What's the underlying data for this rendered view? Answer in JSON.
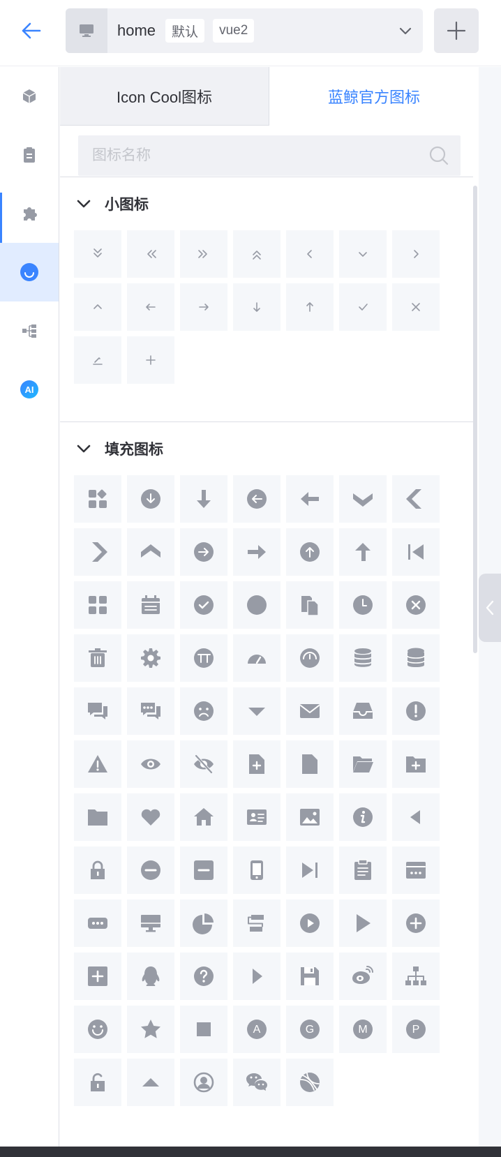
{
  "header": {
    "back_icon": "arrow-left-icon",
    "app_icon": "monitor-icon",
    "app_name": "home",
    "tags": [
      "默认",
      "vue2"
    ],
    "dropdown_icon": "chevron-down-icon",
    "add_icon": "plus-icon"
  },
  "sidebar": {
    "items": [
      {
        "icon": "cube-icon",
        "active": false
      },
      {
        "icon": "clipboard-icon",
        "active": false
      },
      {
        "icon": "puzzle-icon",
        "active": false
      },
      {
        "icon": "smiley-icon",
        "active": true
      },
      {
        "icon": "tree-icon",
        "active": false
      },
      {
        "icon": "ai-icon",
        "label": "AI",
        "active": false
      }
    ]
  },
  "tabs": [
    {
      "label": "Icon Cool图标",
      "active": false
    },
    {
      "label": "蓝鲸官方图标",
      "active": true
    }
  ],
  "search": {
    "placeholder": "图标名称",
    "value": "",
    "icon": "search-icon"
  },
  "sections": [
    {
      "title": "小图标",
      "expand_icon": "chevron-down-icon",
      "icons": [
        "angle-double-down-icon",
        "angle-double-left-icon",
        "angle-double-right-icon",
        "angle-double-up-icon",
        "angle-left-icon",
        "angle-down-icon",
        "angle-right-icon",
        "angle-up-icon",
        "arrows-left-icon",
        "arrows-right-icon",
        "arrows-down-icon",
        "arrows-up-icon",
        "check-icon",
        "close-icon",
        "edit-line-icon",
        "plus-icon"
      ]
    },
    {
      "title": "填充图标",
      "expand_icon": "chevron-down-icon",
      "icons": [
        "apps-icon",
        "download-circle-icon",
        "arrow-down-fill-icon",
        "arrow-left-circle-icon",
        "arrow-left-fill-icon",
        "chevron-down-fill-icon",
        "chevron-left-fill-icon",
        "chevron-right-fill-icon",
        "chevron-up-fill-icon",
        "arrow-right-circle-icon",
        "arrow-right-fill-icon",
        "arrow-up-circle-icon",
        "arrow-up-fill-icon",
        "step-back-icon",
        "grid-icon",
        "calendar-icon",
        "check-circle-icon",
        "circle-icon",
        "copy-icon",
        "clock-icon",
        "close-circle-icon",
        "delete-icon",
        "cog-icon",
        "tt-circle-icon",
        "dashboard-icon",
        "gauge-icon",
        "database-icon",
        "database-alt-icon",
        "chat-icon",
        "chat-dots-icon",
        "sad-face-icon",
        "caret-down-icon",
        "mail-icon",
        "inbox-icon",
        "exclamation-circle-icon",
        "warning-triangle-icon",
        "eye-icon",
        "eye-slash-icon",
        "file-plus-icon",
        "file-icon",
        "folder-open-icon",
        "folder-plus-icon",
        "folder-icon",
        "heart-icon",
        "home-icon",
        "id-card-icon",
        "image-icon",
        "info-circle-icon",
        "triangle-left-icon",
        "lock-icon",
        "minus-circle-icon",
        "minus-square-icon",
        "mobile-icon",
        "step-forward-icon",
        "clipboard-list-icon",
        "more-card-icon",
        "more-pill-icon",
        "desktop-icon",
        "pie-chart-icon",
        "flow-icon",
        "play-circle-icon",
        "play-large-icon",
        "plus-circle-icon",
        "plus-square-icon",
        "qq-icon",
        "question-circle-icon",
        "triangle-right-icon",
        "save-icon",
        "weibo-icon",
        "org-tree-icon",
        "smile-icon",
        "star-icon",
        "stop-icon",
        "letter-a-icon",
        "letter-g-icon",
        "letter-m-icon",
        "letter-p-icon",
        "unlock-icon",
        "caret-up-icon",
        "user-circle-icon",
        "wechat-icon",
        "basketball-icon"
      ]
    }
  ],
  "collapse_icon": "chevron-left-icon",
  "colors": {
    "accent": "#3a84ff",
    "icon": "#979ba5",
    "cell": "#f5f7fa",
    "active_bg": "#e1ecff"
  }
}
